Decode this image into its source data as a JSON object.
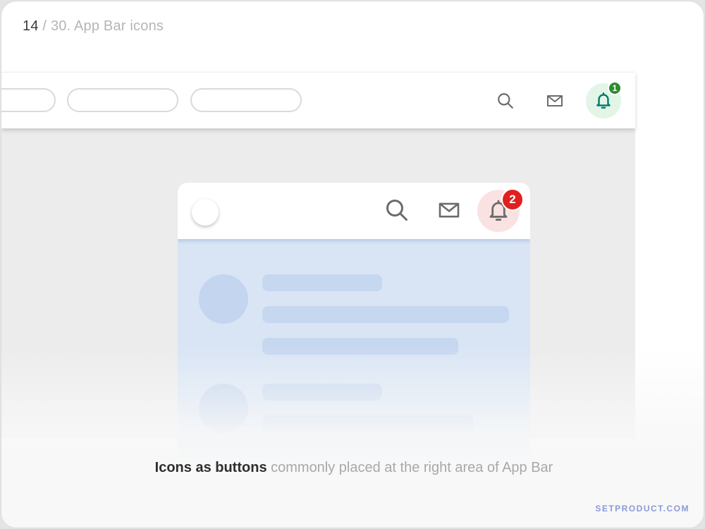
{
  "header": {
    "counter": "14",
    "separator": " / ",
    "title": "30. App Bar icons"
  },
  "top_app_bar": {
    "icons": [
      "search-icon",
      "mail-icon",
      "bell-icon"
    ],
    "notification_count": "1",
    "active_color": "#00796b",
    "active_bg": "#e2f5e6",
    "badge_color": "#2e8b2e"
  },
  "preview_app_bar": {
    "icons": [
      "search-icon",
      "mail-icon",
      "bell-icon"
    ],
    "notification_count": "2",
    "active_bg": "#fbe2e2",
    "badge_color": "#e02020"
  },
  "caption": {
    "strong": "Icons as buttons",
    "rest": " commonly placed at the right area of App Bar"
  },
  "brand": "SETPRODUCT.COM"
}
